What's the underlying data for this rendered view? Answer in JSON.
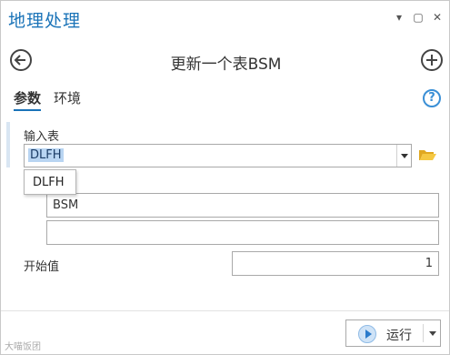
{
  "window": {
    "title": "地理处理",
    "controls": {
      "menu": "▾",
      "restore": "▢",
      "close": "✕"
    }
  },
  "header": {
    "tool_title": "更新一个表BSM",
    "back_icon": "back-arrow-icon",
    "add_icon": "add-plus-icon"
  },
  "tabs": [
    {
      "label": "参数",
      "active": true
    },
    {
      "label": "环境",
      "active": false
    }
  ],
  "help": {
    "label": "?"
  },
  "params": {
    "input_table_label": "输入表",
    "input_table_value": "DLFH",
    "dropdown_options": [
      "DLFH"
    ],
    "fields": [
      {
        "value": "BSM"
      },
      {
        "value": ""
      }
    ],
    "start_value_label": "开始值",
    "start_value": "1"
  },
  "footer": {
    "run_label": "运行"
  },
  "watermark": "大喵饭团",
  "colors": {
    "accent": "#1a73b8",
    "selection": "#b9d5f2",
    "run_icon": "#2b7bcb"
  }
}
